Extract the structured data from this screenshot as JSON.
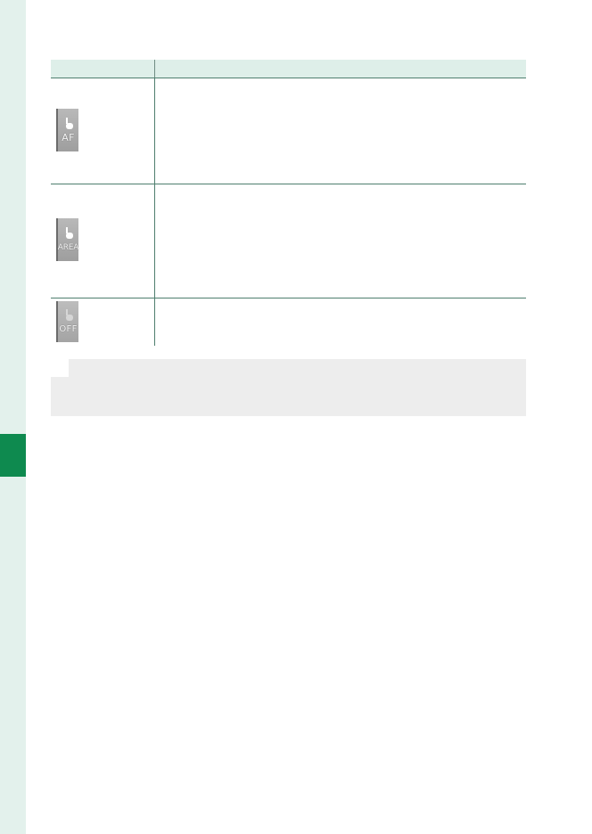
{
  "table": {
    "rows": [
      {
        "icon": "touch-af-icon",
        "label": "AF"
      },
      {
        "icon": "touch-area-icon",
        "label": "AREA"
      },
      {
        "icon": "touch-off-icon",
        "label": "OFF"
      }
    ]
  },
  "colors": {
    "side_strip": "#e3f1ec",
    "side_tab": "#0e8a4f",
    "table_header": "#deefe9",
    "rule": "#4e7e6e",
    "note_bg": "#ededed"
  }
}
